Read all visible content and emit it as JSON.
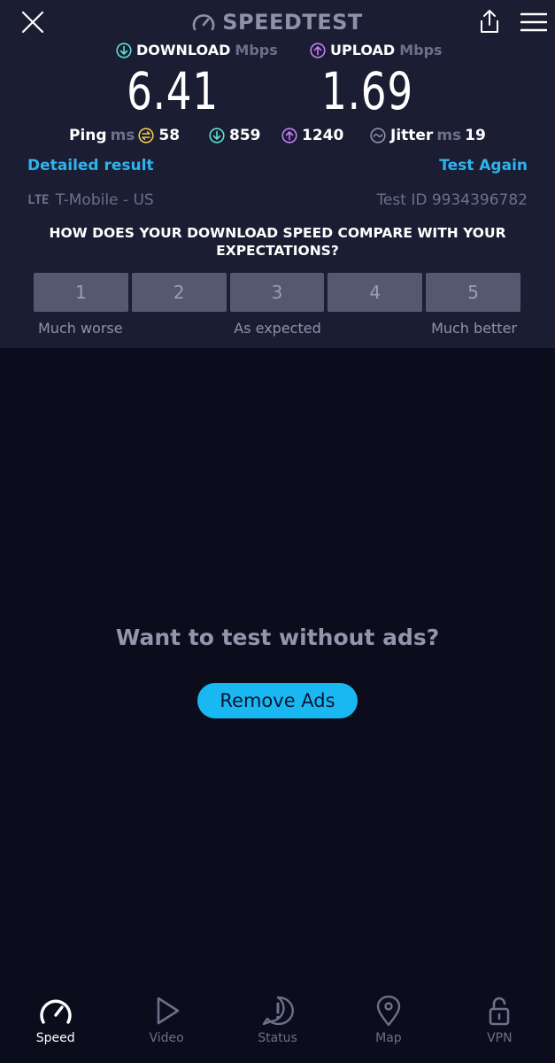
{
  "header": {
    "logo_text": "SPEEDTEST",
    "close_icon": "close-icon",
    "share_icon": "share-icon",
    "menu_icon": "hamburger-menu-icon"
  },
  "results": {
    "download": {
      "label": "DOWNLOAD",
      "unit": "Mbps",
      "value": "6.41",
      "color": "#5ee0d0"
    },
    "upload": {
      "label": "UPLOAD",
      "unit": "Mbps",
      "value": "1.69",
      "color": "#c67df5"
    },
    "ping": {
      "label": "Ping",
      "unit": "ms",
      "idle": "58",
      "download": "859",
      "upload": "1240"
    },
    "jitter": {
      "label": "Jitter",
      "unit": "ms",
      "value": "19"
    }
  },
  "links": {
    "detailed": "Detailed result",
    "test_again": "Test Again"
  },
  "connection": {
    "type": "LTE",
    "carrier": "T-Mobile - US",
    "test_id": "Test ID 9934396782"
  },
  "survey": {
    "question": "HOW DOES YOUR DOWNLOAD SPEED COMPARE WITH YOUR EXPECTATIONS?",
    "options": [
      "1",
      "2",
      "3",
      "4",
      "5"
    ],
    "label_low": "Much worse",
    "label_mid": "As expected",
    "label_high": "Much better"
  },
  "ads": {
    "title": "Want to test without ads?",
    "button": "Remove Ads"
  },
  "tabs": [
    {
      "label": "Speed",
      "icon": "speedometer-icon",
      "active": true
    },
    {
      "label": "Video",
      "icon": "play-icon",
      "active": false
    },
    {
      "label": "Status",
      "icon": "alert-icon",
      "active": false
    },
    {
      "label": "Map",
      "icon": "map-pin-icon",
      "active": false
    },
    {
      "label": "VPN",
      "icon": "lock-icon",
      "active": false
    }
  ],
  "colors": {
    "accent": "#2fb3ee",
    "panel": "#1b1d33",
    "background": "#0b0c1c",
    "ping_icon": "#f2c94c"
  }
}
